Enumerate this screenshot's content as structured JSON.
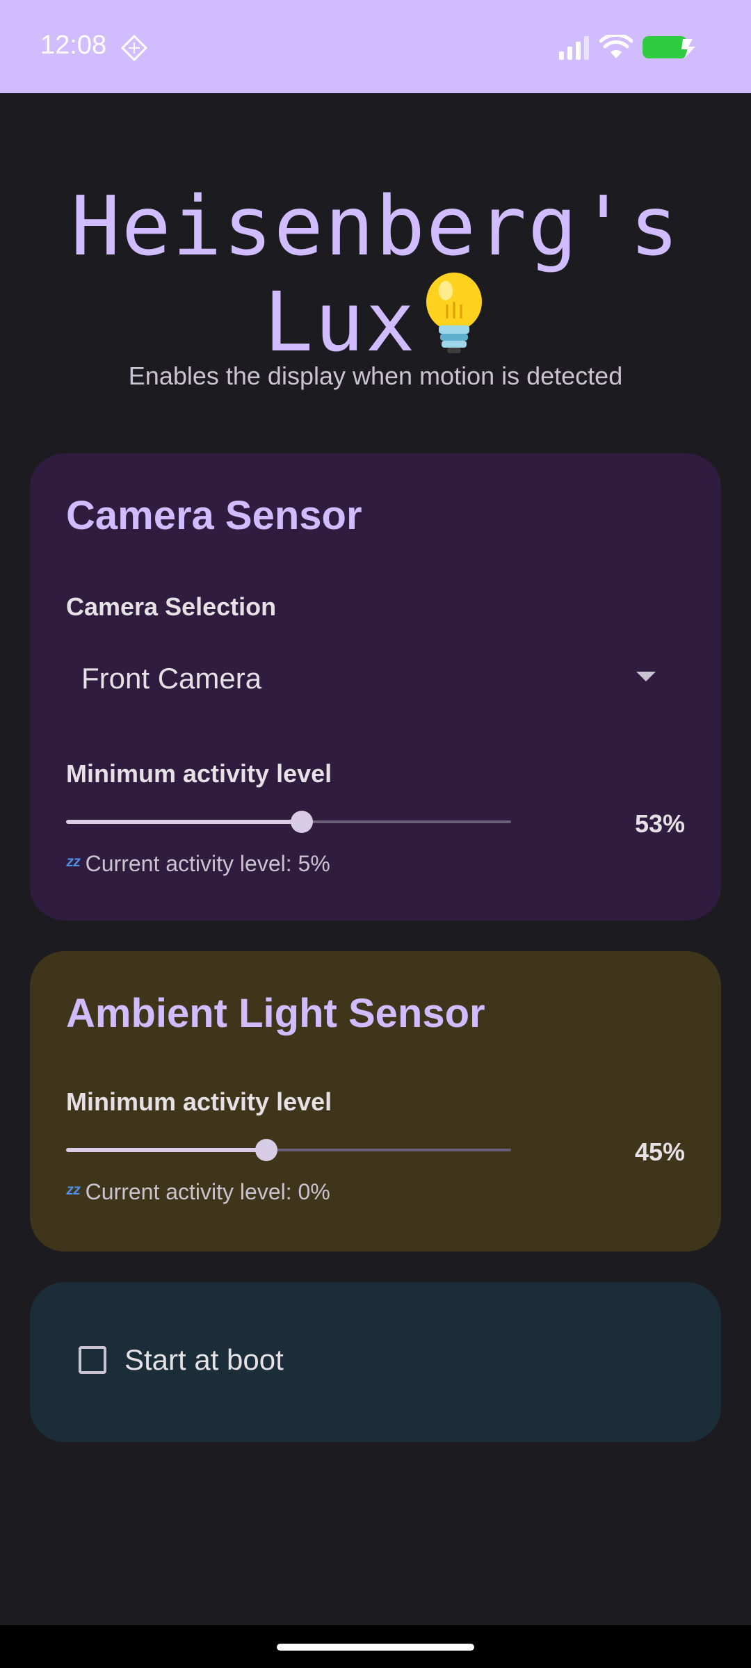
{
  "status_bar": {
    "time": "12:08",
    "icons": [
      "app-notification-icon",
      "signal-icon",
      "wifi-icon",
      "battery-charging-icon"
    ],
    "background": "#d0bcfe"
  },
  "header": {
    "title_line1": "Heisenberg's",
    "title_line2": "Lux",
    "title_emoji": "💡",
    "subtitle": "Enables the display when motion is detected",
    "accent": "#d0bcfe"
  },
  "camera_card": {
    "title": "Camera Sensor",
    "selection_label": "Camera Selection",
    "selected_camera": "Front Camera",
    "min_activity_label": "Minimum activity level",
    "min_activity_value": 53,
    "min_activity_text": "53%",
    "current_activity_text": "Current activity level: 5%",
    "status_icon": "sleeping-zzz-icon",
    "background": "#2f1c3e"
  },
  "light_card": {
    "title": "Ambient Light Sensor",
    "min_activity_label": "Minimum activity level",
    "min_activity_value": 45,
    "min_activity_text": "45%",
    "current_activity_text": "Current activity level: 0%",
    "status_icon": "sleeping-zzz-icon",
    "background": "#3e351b"
  },
  "boot_card": {
    "checkbox_label": "Start at boot",
    "checked": false,
    "background": "#1b2d39"
  }
}
